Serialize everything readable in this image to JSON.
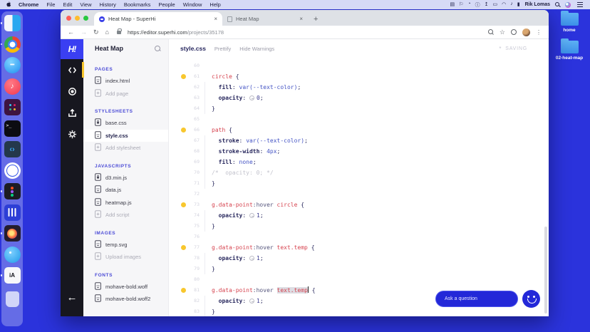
{
  "menubar": {
    "items": [
      "Chrome",
      "File",
      "Edit",
      "View",
      "History",
      "Bookmarks",
      "People",
      "Window",
      "Help"
    ],
    "status_icons": [
      {
        "name": "display-icon",
        "glyph": "▤"
      },
      {
        "name": "vpn-icon",
        "glyph": "⚐"
      },
      {
        "name": "clock-icon",
        "glyph": "◔"
      },
      {
        "name": "info-icon",
        "glyph": "ⓘ"
      },
      {
        "name": "upload-icon",
        "glyph": "↥"
      },
      {
        "name": "monitor-icon",
        "glyph": "▭"
      },
      {
        "name": "wifi-icon",
        "glyph": "◠"
      },
      {
        "name": "volume-icon",
        "glyph": "♪"
      },
      {
        "name": "battery-icon",
        "glyph": "▮"
      }
    ],
    "username": "Rik Lomas"
  },
  "dock": {
    "apps": [
      {
        "name": "finder",
        "running": true,
        "text": ""
      },
      {
        "name": "chrome",
        "running": true,
        "text": ""
      },
      {
        "name": "messages",
        "running": false,
        "text": "•••"
      },
      {
        "name": "music",
        "running": false,
        "text": "♪"
      },
      {
        "name": "slack",
        "running": false,
        "text": ""
      },
      {
        "name": "terminal",
        "running": false,
        "text": ">_"
      },
      {
        "name": "code",
        "running": false,
        "text": "‹›"
      },
      {
        "name": "clock",
        "running": false,
        "text": ""
      },
      {
        "name": "figma",
        "running": true,
        "text": ""
      },
      {
        "name": "lines",
        "running": false,
        "text": ""
      },
      {
        "name": "media",
        "running": true,
        "text": ""
      },
      {
        "name": "bird",
        "running": false,
        "text": ""
      },
      {
        "name": "writer",
        "running": true,
        "text": "iA"
      },
      {
        "name": "trash",
        "running": false,
        "text": ""
      }
    ]
  },
  "desktop": {
    "folders": [
      "home",
      "02-heat-map"
    ]
  },
  "browser": {
    "tabs": [
      {
        "title": "Heat Map - SuperHi",
        "active": true
      },
      {
        "title": "Heat Map",
        "active": false
      }
    ],
    "close_glyph": "×",
    "new_tab": "+",
    "back": "←",
    "forward": "→",
    "reload": "↻",
    "home": "⌂",
    "url_host": "https://editor.superhi.com",
    "url_path": "/projects/35178",
    "star": "☆",
    "dots": "⋮"
  },
  "editor": {
    "logo_text": "H!",
    "project_title": "Heat Map",
    "back_arrow": "←",
    "sidebar_sections": [
      {
        "title": "PAGES",
        "items": [
          {
            "label": "index.html",
            "icon": "doc"
          },
          {
            "label": "Add page",
            "icon": "add",
            "muted": true
          }
        ]
      },
      {
        "title": "STYLESHEETS",
        "items": [
          {
            "label": "base.css",
            "icon": "lock"
          },
          {
            "label": "style.css",
            "icon": "doc",
            "active": true
          },
          {
            "label": "Add stylesheet",
            "icon": "add",
            "muted": true
          }
        ]
      },
      {
        "title": "JAVASCRIPTS",
        "items": [
          {
            "label": "d3.min.js",
            "icon": "lock"
          },
          {
            "label": "data.js",
            "icon": "doc"
          },
          {
            "label": "heatmap.js",
            "icon": "doc"
          },
          {
            "label": "Add script",
            "icon": "add",
            "muted": true
          }
        ]
      },
      {
        "title": "IMAGES",
        "items": [
          {
            "label": "temp.svg",
            "icon": "doc"
          },
          {
            "label": "Upload images",
            "icon": "add",
            "muted": true
          }
        ]
      },
      {
        "title": "FONTS",
        "items": [
          {
            "label": "mohave-bold.woff",
            "icon": "doc"
          },
          {
            "label": "mohave-bold.woff2",
            "icon": "doc"
          }
        ]
      }
    ],
    "header": {
      "filename": "style.css",
      "prettify": "Prettify",
      "hide_warnings": "Hide Warnings",
      "saving_star": "*",
      "saving": "SAVING"
    },
    "chat": {
      "placeholder": "Ask a question"
    },
    "code": {
      "lines": [
        {
          "n": 60,
          "t": []
        },
        {
          "n": 61,
          "m": true,
          "t": [
            [
              "sel",
              "circle"
            ],
            [
              "pl",
              " {"
            ]
          ]
        },
        {
          "n": 62,
          "g": true,
          "t": [
            [
              "pl",
              "  "
            ],
            [
              "prop",
              "fill"
            ],
            [
              "pl",
              ": "
            ],
            [
              "val",
              "var(--text-color)"
            ],
            [
              "pl",
              ";"
            ]
          ]
        },
        {
          "n": 63,
          "g": true,
          "t": [
            [
              "pl",
              "  "
            ],
            [
              "prop",
              "opacity"
            ],
            [
              "pl",
              ": "
            ],
            [
              "wid",
              ""
            ],
            [
              "num",
              "0"
            ],
            [
              "pl",
              ";"
            ]
          ]
        },
        {
          "n": 64,
          "g": true,
          "t": [
            [
              "pl",
              "}"
            ]
          ]
        },
        {
          "n": 65,
          "t": []
        },
        {
          "n": 66,
          "m": true,
          "t": [
            [
              "sel",
              "path"
            ],
            [
              "pl",
              " {"
            ]
          ]
        },
        {
          "n": 67,
          "g": true,
          "t": [
            [
              "pl",
              "  "
            ],
            [
              "prop",
              "stroke"
            ],
            [
              "pl",
              ": "
            ],
            [
              "val",
              "var(--text-color)"
            ],
            [
              "pl",
              ";"
            ]
          ]
        },
        {
          "n": 68,
          "g": true,
          "t": [
            [
              "pl",
              "  "
            ],
            [
              "prop",
              "stroke-width"
            ],
            [
              "pl",
              ": "
            ],
            [
              "val",
              "4px"
            ],
            [
              "pl",
              ";"
            ]
          ]
        },
        {
          "n": 69,
          "g": true,
          "t": [
            [
              "pl",
              "  "
            ],
            [
              "prop",
              "fill"
            ],
            [
              "pl",
              ": "
            ],
            [
              "val",
              "none"
            ],
            [
              "pl",
              ";"
            ]
          ]
        },
        {
          "n": 70,
          "g": true,
          "t": [
            [
              "com",
              "/*  opacity: 0; */"
            ]
          ]
        },
        {
          "n": 71,
          "g": true,
          "t": [
            [
              "pl",
              "}"
            ]
          ]
        },
        {
          "n": 72,
          "t": []
        },
        {
          "n": 73,
          "m": true,
          "t": [
            [
              "sel",
              "g.data-point"
            ],
            [
              "pse",
              ":hover"
            ],
            [
              "sel",
              " circle"
            ],
            [
              "pl",
              " {"
            ]
          ]
        },
        {
          "n": 74,
          "g": true,
          "t": [
            [
              "pl",
              "  "
            ],
            [
              "prop",
              "opacity"
            ],
            [
              "pl",
              ": "
            ],
            [
              "wid",
              ""
            ],
            [
              "num",
              "1"
            ],
            [
              "pl",
              ";"
            ]
          ]
        },
        {
          "n": 75,
          "g": true,
          "t": [
            [
              "pl",
              "}"
            ]
          ]
        },
        {
          "n": 76,
          "t": []
        },
        {
          "n": 77,
          "m": true,
          "t": [
            [
              "sel",
              "g.data-point"
            ],
            [
              "pse",
              ":hover"
            ],
            [
              "sel",
              " text.temp"
            ],
            [
              "pl",
              " {"
            ]
          ]
        },
        {
          "n": 78,
          "g": true,
          "t": [
            [
              "pl",
              "  "
            ],
            [
              "prop",
              "opacity"
            ],
            [
              "pl",
              ": "
            ],
            [
              "wid",
              ""
            ],
            [
              "num",
              "1"
            ],
            [
              "pl",
              ";"
            ]
          ]
        },
        {
          "n": 79,
          "g": true,
          "t": [
            [
              "pl",
              "}"
            ]
          ]
        },
        {
          "n": 80,
          "t": []
        },
        {
          "n": 81,
          "m": true,
          "t": [
            [
              "sel",
              "g.data-point"
            ],
            [
              "pse",
              ":hover"
            ],
            [
              "pl",
              " "
            ],
            [
              "selh",
              "text.temp"
            ],
            [
              "caret",
              ""
            ],
            [
              "pl",
              " {"
            ]
          ]
        },
        {
          "n": 82,
          "g": true,
          "t": [
            [
              "pl",
              "  "
            ],
            [
              "prop",
              "opacity"
            ],
            [
              "pl",
              ": "
            ],
            [
              "wid",
              ""
            ],
            [
              "num",
              "1"
            ],
            [
              "pl",
              ";"
            ]
          ]
        },
        {
          "n": 83,
          "g": true,
          "t": [
            [
              "pl",
              "}"
            ]
          ]
        }
      ]
    }
  },
  "colors": {
    "desktop_blue": "#2b33dc",
    "superhi_blue": "#3a3ff2",
    "marker_yellow": "#f8c72e",
    "selector_red": "#d6434f",
    "value_blue": "#4353c4",
    "chat_blue": "#2328d8"
  }
}
